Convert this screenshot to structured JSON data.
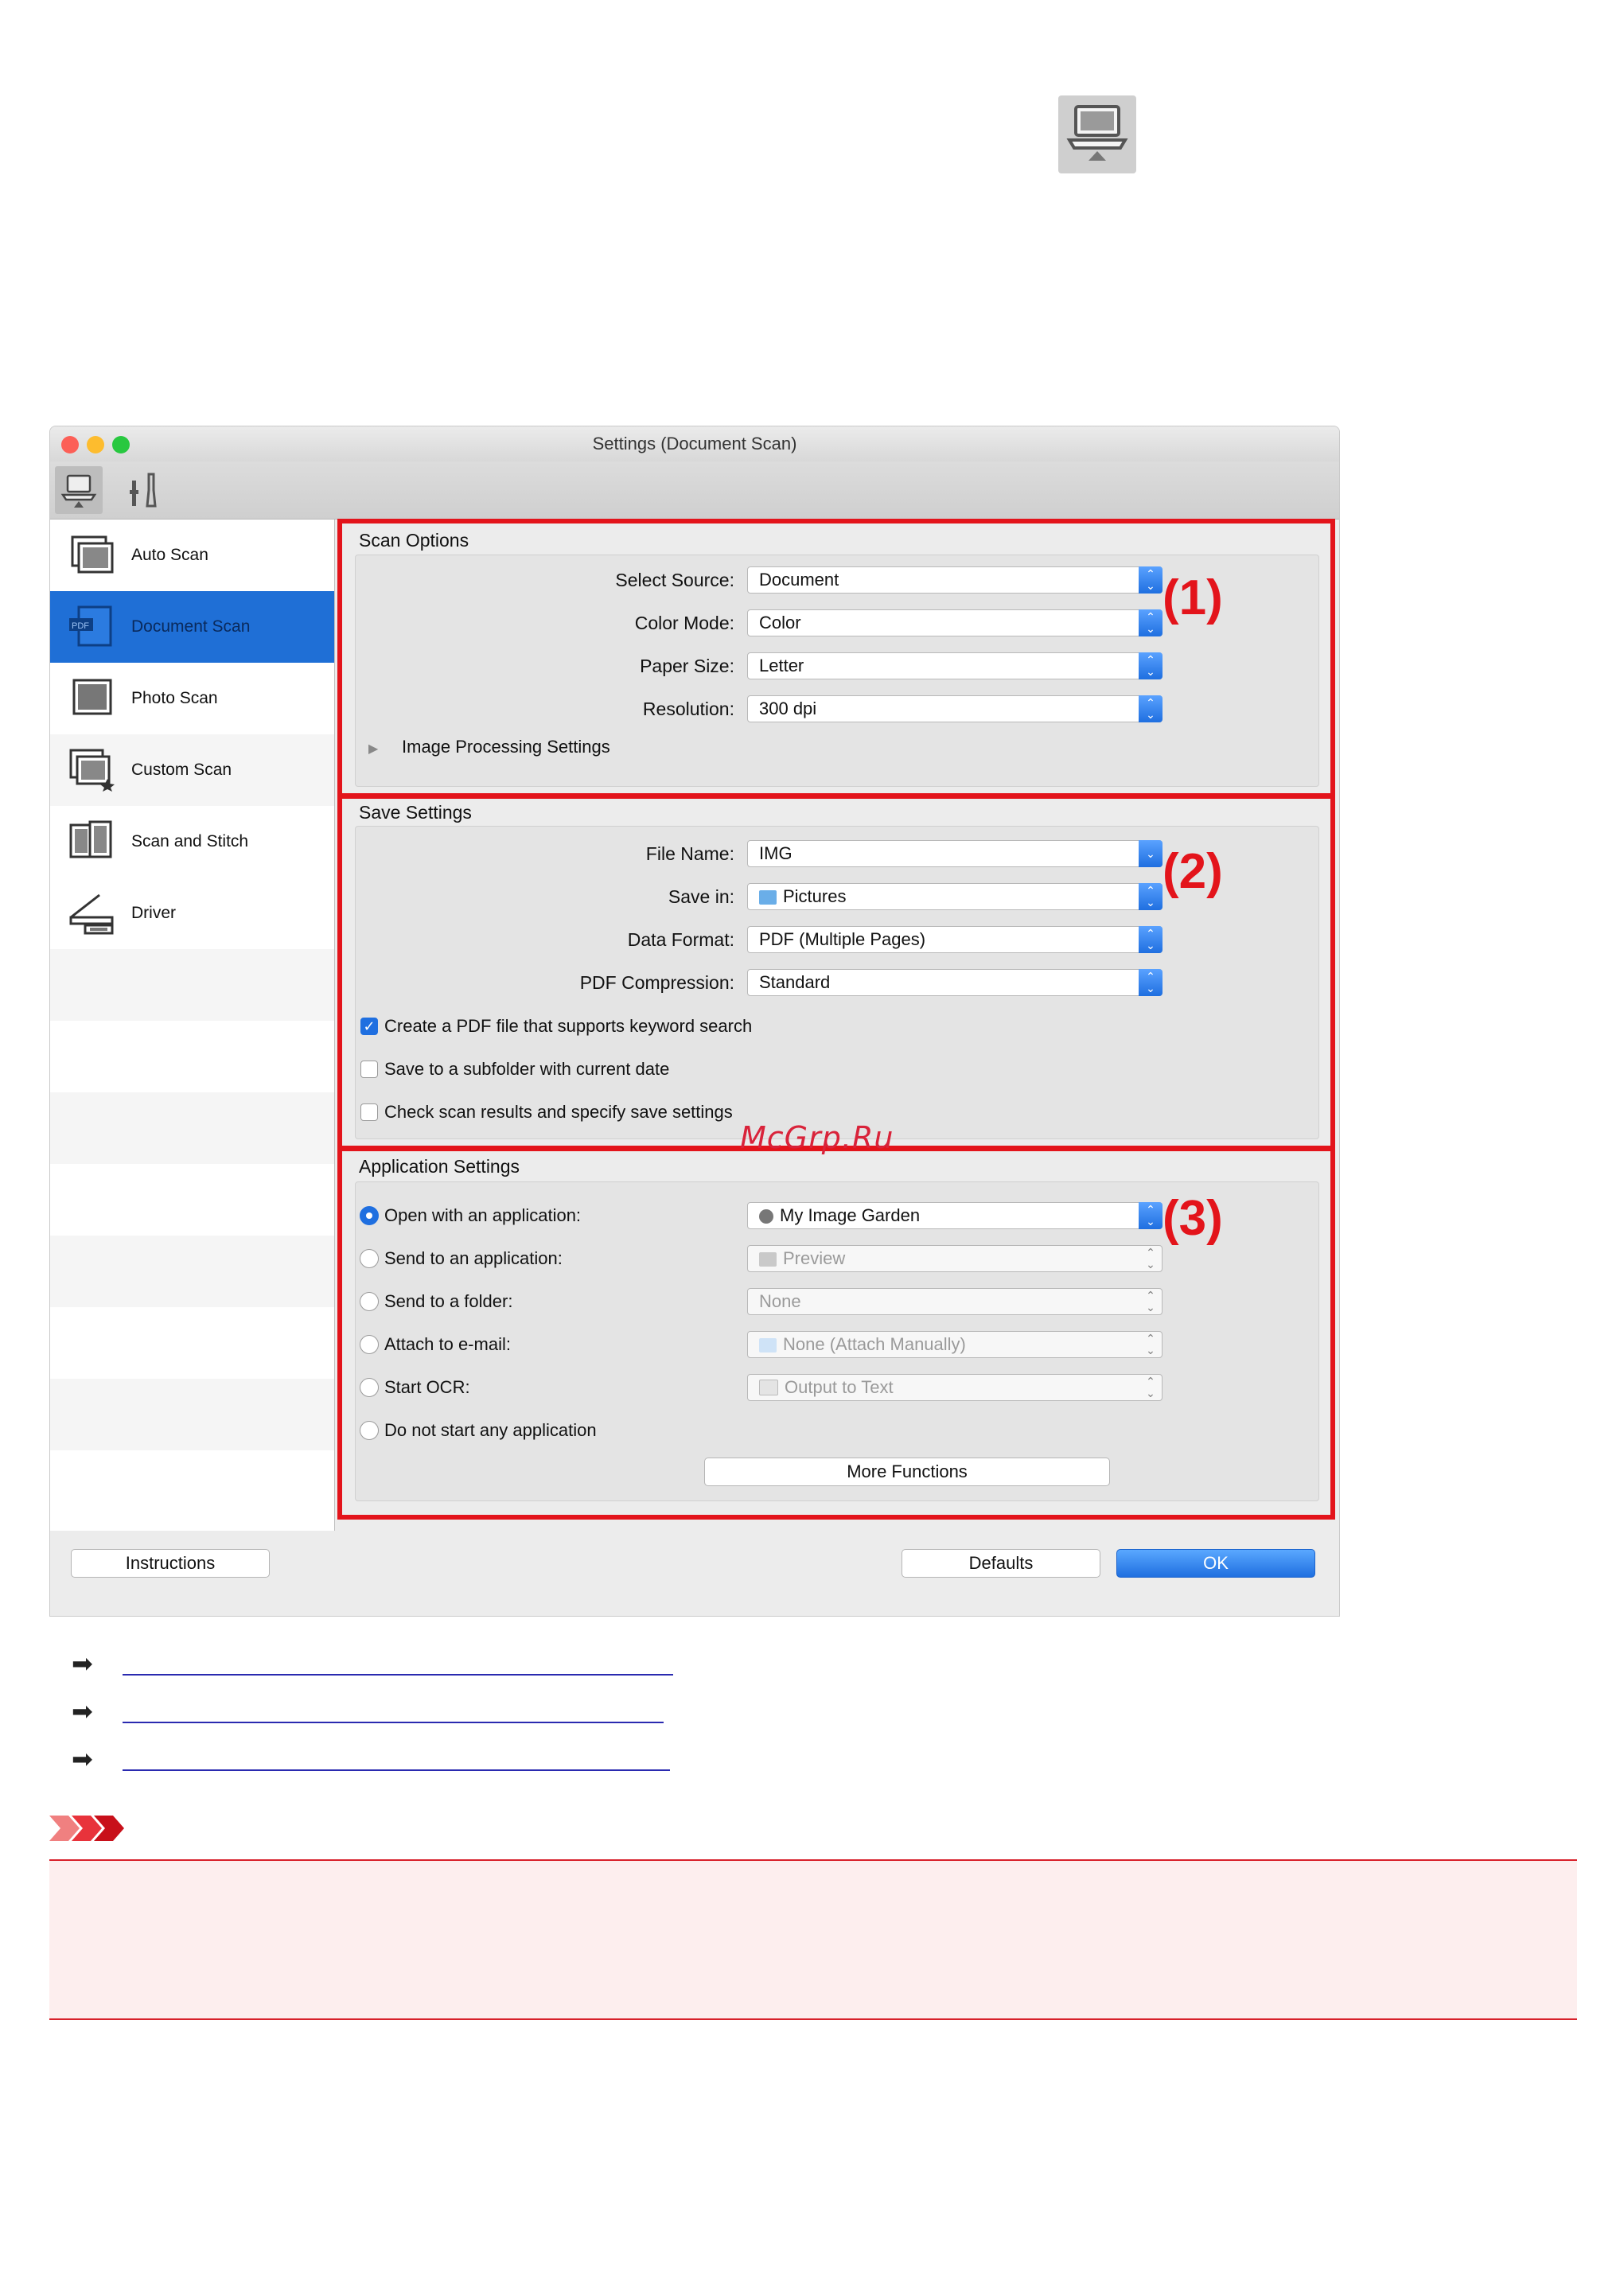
{
  "window": {
    "title": "Settings (Document Scan)",
    "traffic_light_colors": [
      "#fc5f57",
      "#fdbc2e",
      "#28c840"
    ]
  },
  "toolbar": {
    "tabs": [
      {
        "icon": "scan-from-computer-icon",
        "selected": true
      },
      {
        "icon": "general-settings-icon",
        "selected": false
      }
    ]
  },
  "sidebar": {
    "items": [
      {
        "label": "Auto Scan",
        "icon": "auto-scan-icon",
        "selected": false
      },
      {
        "label": "Document Scan",
        "icon": "document-scan-icon",
        "selected": true
      },
      {
        "label": "Photo Scan",
        "icon": "photo-scan-icon",
        "selected": false
      },
      {
        "label": "Custom Scan",
        "icon": "custom-scan-icon",
        "selected": false
      },
      {
        "label": "Scan and Stitch",
        "icon": "scan-and-stitch-icon",
        "selected": false
      },
      {
        "label": "Driver",
        "icon": "driver-icon",
        "selected": false
      }
    ]
  },
  "scan_options": {
    "title": "Scan Options",
    "callout": "(1)",
    "rows": [
      {
        "label": "Select Source:",
        "value": "Document"
      },
      {
        "label": "Color Mode:",
        "value": "Color"
      },
      {
        "label": "Paper Size:",
        "value": "Letter"
      },
      {
        "label": "Resolution:",
        "value": "300 dpi"
      }
    ],
    "image_processing_label": "Image Processing Settings"
  },
  "save_settings": {
    "title": "Save Settings",
    "callout": "(2)",
    "rows": [
      {
        "label": "File Name:",
        "value": "IMG"
      },
      {
        "label": "Save in:",
        "value": "Pictures"
      },
      {
        "label": "Data Format:",
        "value": "PDF (Multiple Pages)"
      },
      {
        "label": "PDF Compression:",
        "value": "Standard"
      }
    ],
    "checkboxes": [
      {
        "label": "Create a PDF file that supports keyword search",
        "checked": true
      },
      {
        "label": "Save to a subfolder with current date",
        "checked": false
      },
      {
        "label": "Check scan results and specify save settings",
        "checked": false
      }
    ]
  },
  "application_settings": {
    "title": "Application Settings",
    "callout": "(3)",
    "options": [
      {
        "label": "Open with an application:",
        "selected": true,
        "value": "My Image Garden",
        "enabled": true
      },
      {
        "label": "Send to an application:",
        "selected": false,
        "value": "Preview",
        "enabled": false
      },
      {
        "label": "Send to a folder:",
        "selected": false,
        "value": "None",
        "enabled": false
      },
      {
        "label": "Attach to e-mail:",
        "selected": false,
        "value": "None (Attach Manually)",
        "enabled": false
      },
      {
        "label": "Start OCR:",
        "selected": false,
        "value": "Output to Text",
        "enabled": false
      },
      {
        "label": "Do not start any application",
        "selected": false
      }
    ],
    "more_functions_label": "More Functions"
  },
  "footer": {
    "instructions_label": "Instructions",
    "defaults_label": "Defaults",
    "ok_label": "OK"
  },
  "watermark": "McGrp.Ru",
  "accent_color": "#1f6fe0",
  "callout_color": "#e3141b"
}
